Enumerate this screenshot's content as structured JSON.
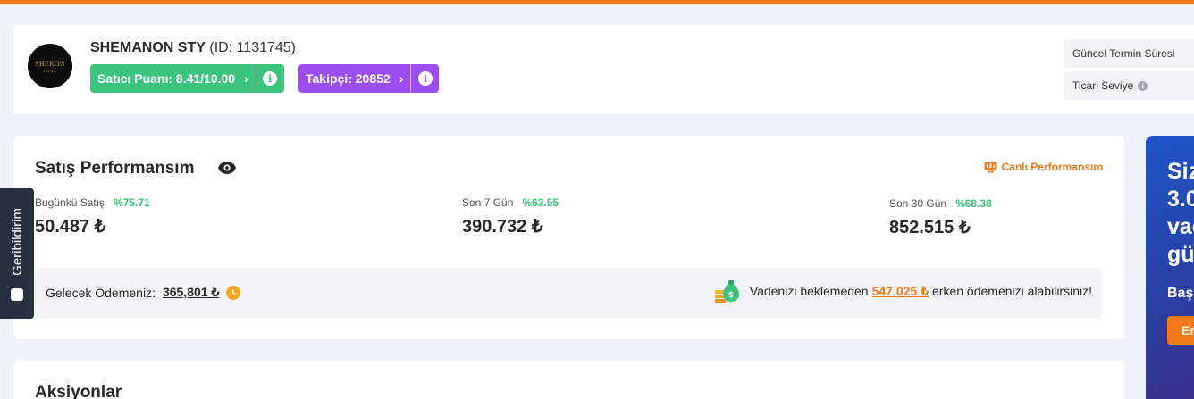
{
  "seller": {
    "logo_text_1": "SHERON",
    "logo_text_2": "JEWEL",
    "name": "SHEMANON STY",
    "id_text": "(ID: 1131745)",
    "score_label": "Satıcı Puanı: 8.41/10.00",
    "followers_label": "Takipçi: 20852",
    "info_glyph": "i",
    "chevron": "›"
  },
  "side_fields": {
    "current_term": "Güncel Termin Süresi",
    "trade_level": "Ticari Seviye"
  },
  "performance": {
    "title": "Satış Performansım",
    "live_link": "Canlı Performansım",
    "stats": [
      {
        "label": "Bugünkü Satış",
        "pct": "%75.71",
        "value": "50.487 ₺"
      },
      {
        "label": "Son 7 Gün",
        "pct": "%63.55",
        "value": "390.732 ₺"
      },
      {
        "label": "Son 30 Gün",
        "pct": "%68.38",
        "value": "852.515 ₺"
      }
    ],
    "future_payment_label": "Gelecek Ödemeniz:",
    "future_payment_amount": "365,801 ₺",
    "early_pay_prefix": "Vadenizi beklemeden",
    "early_pay_amount": "547.025 ₺",
    "early_pay_suffix": "erken ödemenizi alabilirsiniz!"
  },
  "feedback": {
    "label": "Geribildirim"
  },
  "actions": {
    "title": "Aksiyonlar"
  },
  "promo": {
    "line1": "Siz",
    "line2": "3.0",
    "line3": "vac",
    "line4": "gü",
    "sub": "Baş",
    "button": "Er"
  },
  "colors": {
    "accent": "#f27a1a",
    "green": "#3ac47d",
    "purple": "#9b4df0",
    "dark": "#273142"
  }
}
